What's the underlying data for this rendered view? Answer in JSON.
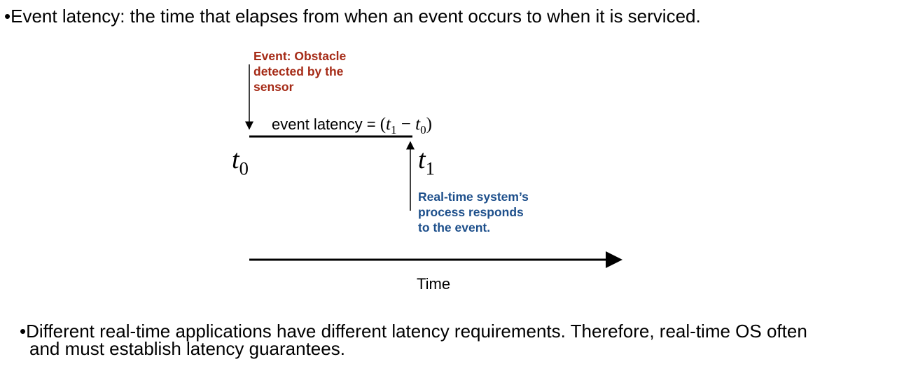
{
  "bullets": [
    "Event latency: the time that elapses from when an event occurs to when it is serviced.",
    "Different real-time applications have different latency requirements. Therefore, real-time OS often",
    "and must establish latency guarantees."
  ],
  "diagram": {
    "event_label": [
      "Event: Obstacle",
      "detected by the",
      "sensor"
    ],
    "response_label": [
      "Real-time system’s",
      "process responds",
      "to the event."
    ],
    "equation_prefix": "event latency = ",
    "equation": {
      "open": "(",
      "t1": "t",
      "t1_sub": "1",
      "minus": " − ",
      "t0": "t",
      "t0_sub": "0",
      "close": ")"
    },
    "t0": {
      "var": "t",
      "sub": "0"
    },
    "t1": {
      "var": "t",
      "sub": "1"
    },
    "axis_label": "Time",
    "colors": {
      "event": "#A52A16",
      "response": "#1D4F8B"
    }
  }
}
